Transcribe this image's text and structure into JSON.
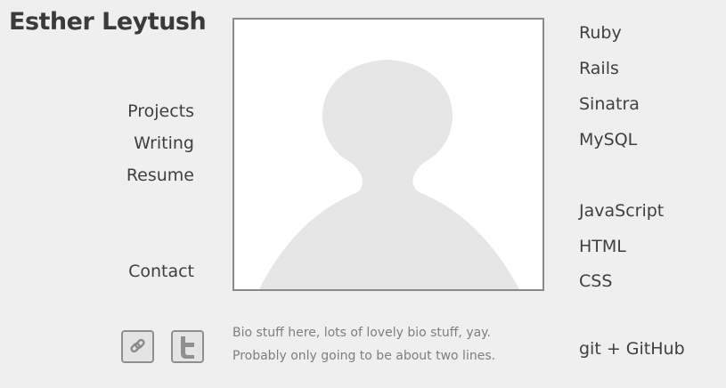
{
  "header": {
    "name": "Esther Leytush"
  },
  "nav": {
    "projects": "Projects",
    "writing": "Writing",
    "resume": "Resume",
    "contact": "Contact"
  },
  "skills": [
    "Ruby",
    "Rails",
    "Sinatra",
    "MySQL",
    "JavaScript",
    "HTML",
    "CSS",
    "git + GitHub"
  ],
  "bio": {
    "line1": "Bio stuff here, lots of lovely bio stuff, yay.",
    "line2": "Probably only going to be about two lines."
  },
  "social": {
    "link_icon": "link-icon",
    "twitter_icon": "twitter-icon"
  },
  "colors": {
    "background": "#efefef",
    "text": "#3f3f3f",
    "bio_text": "#7e7e7e",
    "frame_border": "#8a8a8a",
    "silhouette": "#e6e6e6"
  }
}
